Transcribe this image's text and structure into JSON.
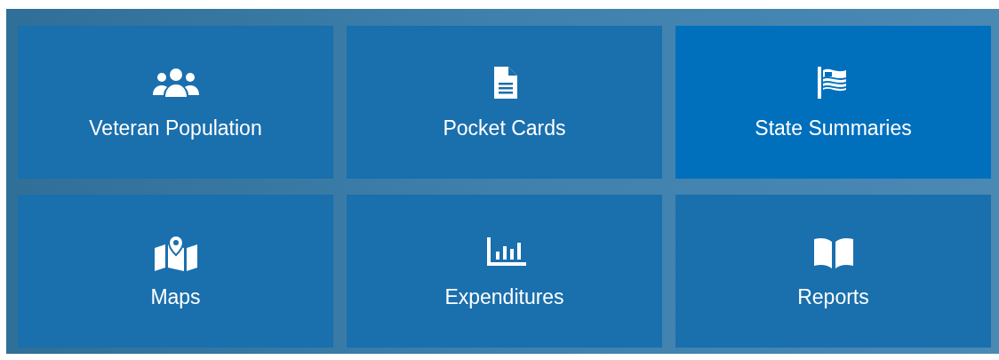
{
  "tiles": [
    {
      "label": "Veteran Population",
      "selected": false
    },
    {
      "label": "Pocket Cards",
      "selected": false
    },
    {
      "label": "State Summaries",
      "selected": true
    },
    {
      "label": "Maps",
      "selected": false
    },
    {
      "label": "Expenditures",
      "selected": false
    },
    {
      "label": "Reports",
      "selected": false
    }
  ]
}
